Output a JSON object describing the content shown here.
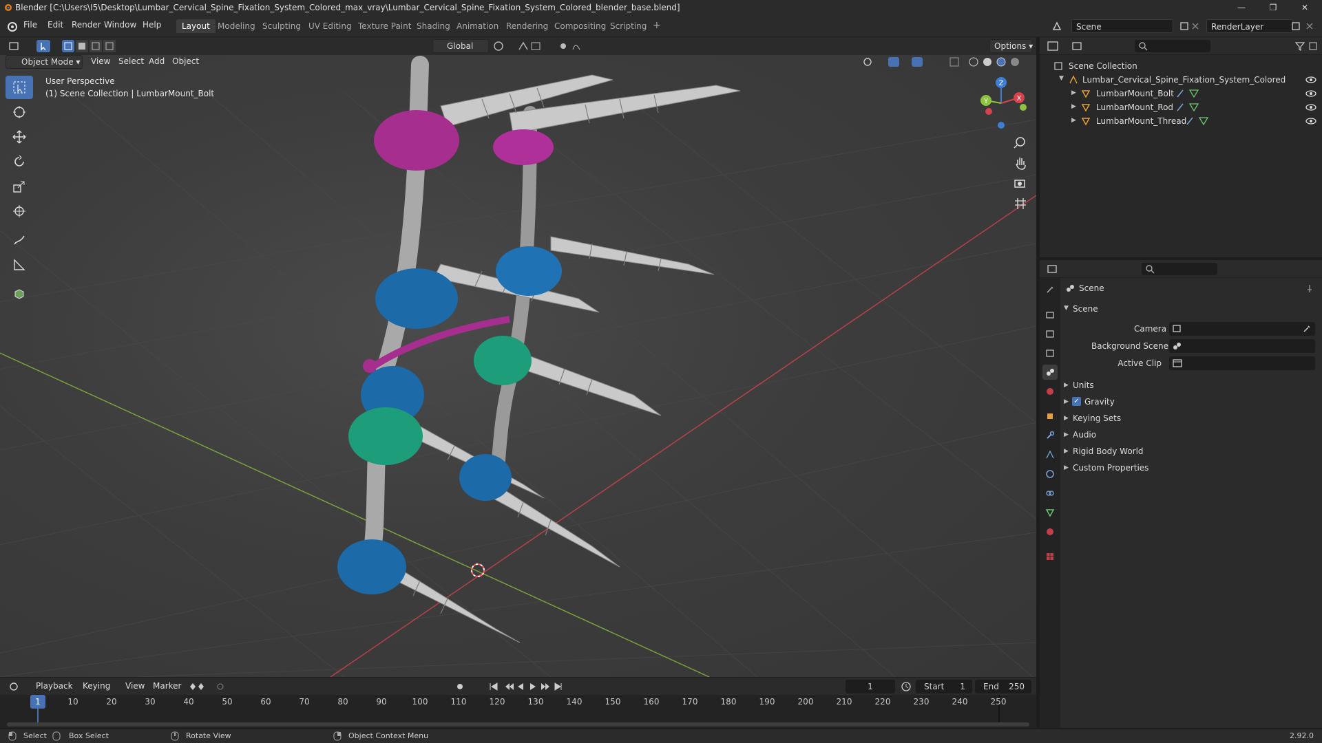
{
  "window": {
    "title": "Blender [C:\\Users\\I5\\Desktop\\Lumbar_Cervical_Spine_Fixation_System_Colored_max_vray\\Lumbar_Cervical_Spine_Fixation_System_Colored_blender_base.blend]",
    "minimize": "—",
    "maximize": "❐",
    "close": "✕"
  },
  "menu": {
    "items": [
      "File",
      "Edit",
      "Render",
      "Window",
      "Help"
    ],
    "workspaces": [
      "Layout",
      "Modeling",
      "Sculpting",
      "UV Editing",
      "Texture Paint",
      "Shading",
      "Animation",
      "Rendering",
      "Compositing",
      "Scripting"
    ],
    "active_workspace": "Layout",
    "add_tab": "+",
    "scene_field": "Scene",
    "renderlayer_field": "RenderLayer"
  },
  "viewport": {
    "mode": "Object Mode",
    "menus": [
      "View",
      "Select",
      "Add",
      "Object"
    ],
    "transform_orientation": "Global",
    "options_label": "Options",
    "info_line1": "User Perspective",
    "info_line2": "(1) Scene Collection | LumbarMount_Bolt",
    "gizmo_axes": {
      "x": "X",
      "y": "Y",
      "z": "Z"
    }
  },
  "outliner": {
    "root": "Scene Collection",
    "collection": "Lumbar_Cervical_Spine_Fixation_System_Colored",
    "objects": [
      "LumbarMount_Bolt",
      "LumbarMount_Rod",
      "LumbarMount_Thread"
    ]
  },
  "properties": {
    "header": "Scene",
    "panel_title": "Scene",
    "camera_label": "Camera",
    "background_scene_label": "Background Scene",
    "active_clip_label": "Active Clip",
    "sections": [
      "Units",
      "Gravity",
      "Keying Sets",
      "Audio",
      "Rigid Body World",
      "Custom Properties"
    ],
    "gravity_checked": true
  },
  "timeline": {
    "menus": [
      "Playback",
      "Keying",
      "View",
      "Marker"
    ],
    "current_frame": "1",
    "start_label": "Start",
    "start_value": "1",
    "end_label": "End",
    "end_value": "250",
    "ruler": [
      "1",
      "10",
      "20",
      "30",
      "40",
      "50",
      "60",
      "70",
      "80",
      "90",
      "100",
      "110",
      "120",
      "130",
      "140",
      "150",
      "160",
      "170",
      "180",
      "190",
      "200",
      "210",
      "220",
      "230",
      "240",
      "250"
    ]
  },
  "statusbar": {
    "select": "Select",
    "box_select": "Box Select",
    "rotate_view": "Rotate View",
    "context_menu": "Object Context Menu",
    "version": "2.92.0"
  },
  "colors": {
    "accent": "#4772b3",
    "x_axis": "#d6434f",
    "y_axis": "#8ec33f",
    "z_axis": "#3d7fd6",
    "implant_magenta": "#a62e8f",
    "implant_blue": "#1c6aa8",
    "implant_green": "#1e9d7a"
  }
}
